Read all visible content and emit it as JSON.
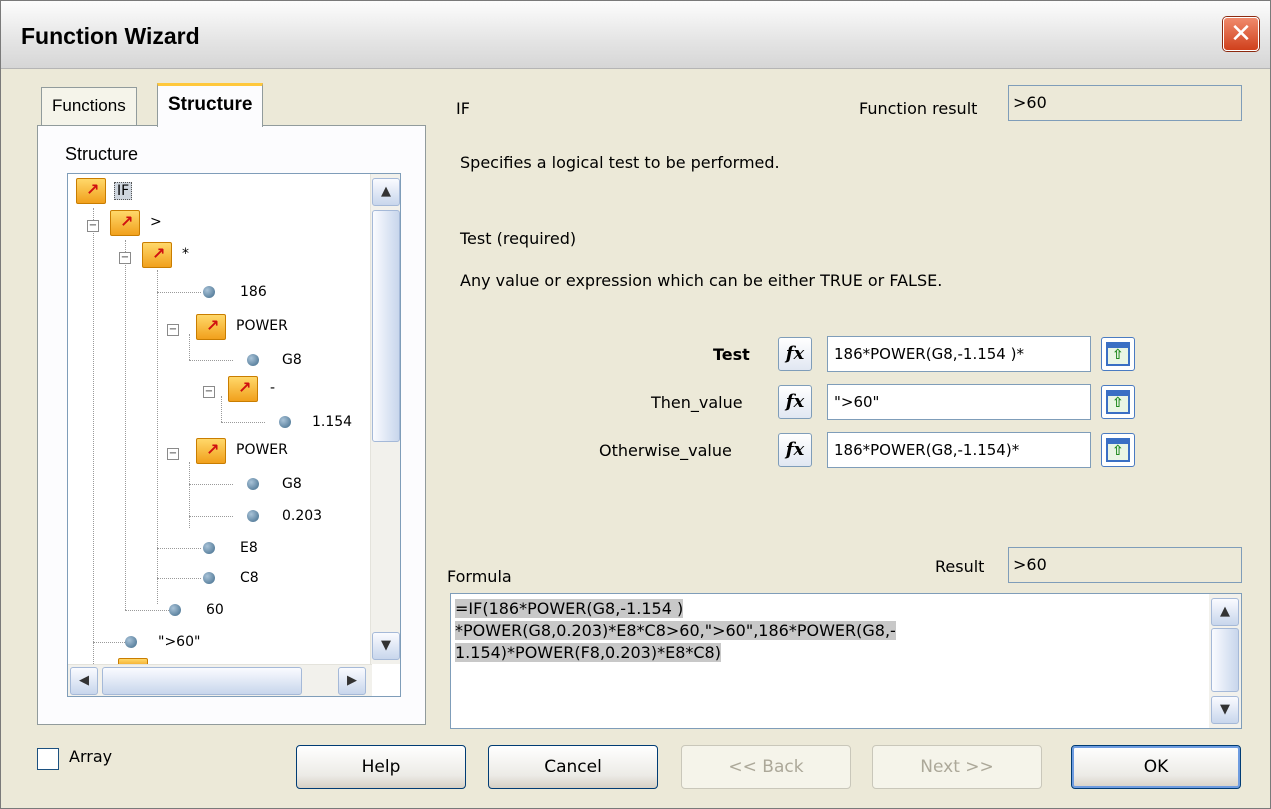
{
  "window": {
    "title": "Function Wizard",
    "close_glyph": "✕"
  },
  "tabs": [
    {
      "label": "Functions"
    },
    {
      "label": "Structure"
    }
  ],
  "structure_label": "Structure",
  "tree": {
    "nodes": [
      "IF",
      ">",
      "*",
      "186",
      "POWER",
      "G8",
      "-",
      "1.154",
      "POWER",
      "G8",
      "0.203",
      "E8",
      "C8",
      "60",
      "\">60\""
    ]
  },
  "function": {
    "name": "IF",
    "result_label": "Function result",
    "result_value": ">60",
    "description": "Specifies a logical test to be performed.",
    "param_heading": "Test (required)",
    "param_description": "Any value or expression which can be either TRUE or FALSE."
  },
  "args": [
    {
      "label": "Test",
      "value": "186*POWER(G8,-1.154 )*"
    },
    {
      "label": "Then_value",
      "value": "\">60\""
    },
    {
      "label": "Otherwise_value",
      "value": "186*POWER(G8,-1.154)*"
    }
  ],
  "formula": {
    "label": "Formula",
    "result_label": "Result",
    "result_value": ">60",
    "line1": "=IF(186*POWER(G8,-1.154 )",
    "line2": "*POWER(G8,0.203)*E8*C8>60,\">60\",186*POWER(G8,-",
    "line3": "1.154)*POWER(F8,0.203)*E8*C8)"
  },
  "array_label": "Array",
  "buttons": {
    "help": "Help",
    "cancel": "Cancel",
    "back": "<< Back",
    "next": "Next >>",
    "ok": "OK"
  },
  "colors": {
    "dialog_bg": "#ece9d8",
    "folder": "#f1a01c",
    "close": "#d0401c"
  }
}
